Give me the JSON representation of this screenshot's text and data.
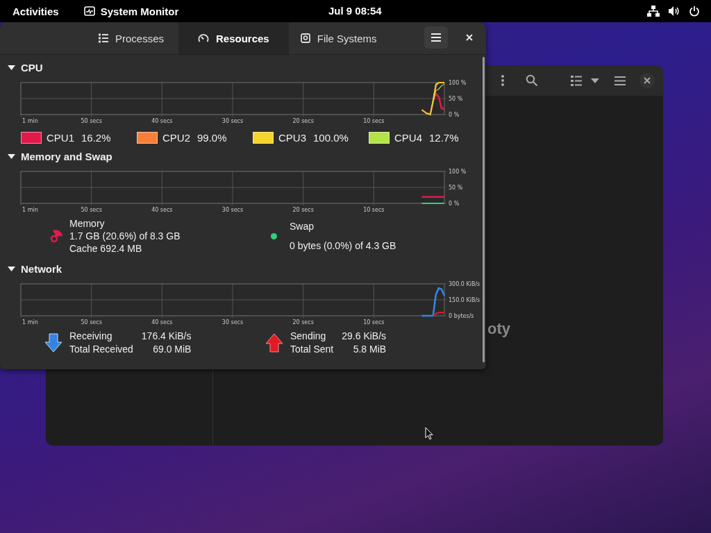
{
  "top_bar": {
    "activities": "Activities",
    "app_name": "System Monitor",
    "clock": "Jul 9  08:54"
  },
  "window": {
    "tabs": [
      {
        "label": "Processes",
        "selected": false,
        "kind": "list"
      },
      {
        "label": "Resources",
        "selected": true,
        "kind": "gauge"
      },
      {
        "label": "File Systems",
        "selected": false,
        "kind": "disk"
      }
    ]
  },
  "cpu": {
    "title": "CPU",
    "expanded": true,
    "x_start_label": "1 min",
    "chart_data": {
      "type": "line",
      "x": [
        3.2,
        2.6,
        2,
        1.6,
        1.2,
        0.8,
        0.4,
        0
      ],
      "xlim": [
        60,
        0
      ],
      "ylim": [
        0,
        100
      ],
      "xticks": [
        {
          "value": 50,
          "label": "50 secs"
        },
        {
          "value": 40,
          "label": "40 secs"
        },
        {
          "value": 30,
          "label": "30 secs"
        },
        {
          "value": 20,
          "label": "20 secs"
        },
        {
          "value": 10,
          "label": "10 secs"
        }
      ],
      "yticks": [
        {
          "value": 100,
          "label": "100 %"
        },
        {
          "value": 50,
          "label": "50 %"
        },
        {
          "value": 0,
          "label": "0 %"
        }
      ],
      "series": [
        {
          "name": "CPU1",
          "color": "#e01b4b",
          "values": [
            15,
            5,
            0,
            40,
            65,
            55,
            20,
            16
          ]
        },
        {
          "name": "CPU2",
          "color": "#f6803a",
          "values": [
            15,
            5,
            0,
            40,
            90,
            100,
            100,
            99
          ]
        },
        {
          "name": "CPU3",
          "color": "#f6d32d",
          "values": [
            null,
            4,
            0,
            45,
            95,
            100,
            100,
            100
          ]
        },
        {
          "name": "CPU4",
          "color": "#b5e34a",
          "values": [
            14,
            5,
            0,
            40,
            75,
            80,
            90,
            95
          ]
        }
      ],
      "grid": true
    },
    "legend": [
      {
        "value": "16.2%"
      },
      {
        "value": "99.0%"
      },
      {
        "value": "100.0%"
      },
      {
        "value": "12.7%"
      }
    ]
  },
  "memory": {
    "title": "Memory and Swap",
    "expanded": true,
    "x_start_label": "1 min",
    "chart_data": {
      "type": "line",
      "x": [
        3.2,
        0
      ],
      "xlim": [
        60,
        0
      ],
      "ylim": [
        0,
        100
      ],
      "xticks": [
        {
          "value": 50,
          "label": "50 secs"
        },
        {
          "value": 40,
          "label": "40 secs"
        },
        {
          "value": 30,
          "label": "30 secs"
        },
        {
          "value": 20,
          "label": "20 secs"
        },
        {
          "value": 10,
          "label": "10 secs"
        }
      ],
      "yticks": [
        {
          "value": 100,
          "label": "100 %"
        },
        {
          "value": 50,
          "label": "50 %"
        },
        {
          "value": 0,
          "label": "0 %"
        }
      ],
      "series": [
        {
          "name": "Memory",
          "color": "#e01b4b",
          "values": [
            20,
            20
          ]
        },
        {
          "name": "Swap",
          "color": "#33d17a",
          "values": [
            0,
            0
          ]
        }
      ],
      "grid": true
    },
    "memory": {
      "usage": "1.7 GB (20.6%) of 8.3 GB",
      "cache": "Cache 692.4 MB"
    },
    "swap": {
      "usage": "0 bytes (0.0%) of 4.3 GB"
    }
  },
  "network": {
    "title": "Network",
    "expanded": true,
    "x_start_label": "1 min",
    "chart_data": {
      "type": "line",
      "x": [
        3.2,
        2.4,
        1.6,
        1.2,
        0.8,
        0.4,
        0
      ],
      "xlim": [
        60,
        0
      ],
      "ylim": [
        0,
        300
      ],
      "xticks": [
        {
          "value": 50,
          "label": "50 secs"
        },
        {
          "value": 40,
          "label": "40 secs"
        },
        {
          "value": 30,
          "label": "30 secs"
        },
        {
          "value": 20,
          "label": "20 secs"
        },
        {
          "value": 10,
          "label": "10 secs"
        }
      ],
      "yticks": [
        {
          "value": 300,
          "label": "300.0 KiB/s"
        },
        {
          "value": 150,
          "label": "150.0 KiB/s"
        },
        {
          "value": 0,
          "label": "0 bytes/s"
        }
      ],
      "series": [
        {
          "name": "Receiving",
          "color": "#3584e4",
          "values": [
            0,
            0,
            0,
            200,
            260,
            250,
            190
          ]
        },
        {
          "name": "Sending",
          "color": "#e01b24",
          "values": [
            null,
            null,
            0,
            20,
            30,
            30,
            30
          ]
        }
      ],
      "grid": true
    },
    "receiving": {
      "value": "176.4 KiB/s",
      "total_label": "Total Received",
      "total": "69.0 MiB"
    },
    "sending": {
      "value": "29.6 KiB/s",
      "total_label": "Total Sent",
      "total": "5.8 MiB"
    }
  },
  "background_window": {
    "empty_text": "oty"
  }
}
